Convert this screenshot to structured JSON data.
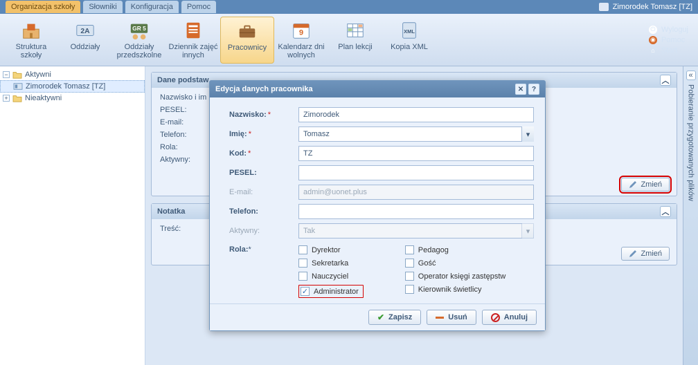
{
  "header": {
    "tabs": [
      "Organizacja szkoły",
      "Słowniki",
      "Konfiguracja",
      "Pomoc"
    ],
    "active_tab": 0,
    "user": "Zimorodek Tomasz [TZ]",
    "links": {
      "logout": "Wyloguj",
      "help": "Pomoc",
      "start": "Start"
    }
  },
  "ribbon": {
    "items": [
      {
        "label": "Struktura szkoły"
      },
      {
        "label": "Oddziały",
        "badge": "2A"
      },
      {
        "label": "Oddziały przedszkolne",
        "badge": "GR 5"
      },
      {
        "label": "Dziennik zajęć innych"
      },
      {
        "label": "Pracownicy"
      },
      {
        "label": "Kalendarz dni wolnych"
      },
      {
        "label": "Plan lekcji"
      },
      {
        "label": "Kopia XML"
      }
    ],
    "active": 4
  },
  "tree": {
    "active_label": "Aktywni",
    "active_child": "Zimorodek Tomasz [TZ]",
    "inactive_label": "Nieaktywni"
  },
  "panel_main": {
    "title": "Dane podstaw",
    "fields": {
      "name_label": "Nazwisko i im",
      "pesel_label": "PESEL:",
      "email_label": "E-mail:",
      "telefon_label": "Telefon:",
      "rola_label": "Rola:",
      "aktywny_label": "Aktywny:"
    },
    "btn": "Zmień"
  },
  "panel_note": {
    "title": "Notatka",
    "tresc_label": "Treść:",
    "btn": "Zmień"
  },
  "sider": {
    "text": "Pobieranie przygotowanych plików"
  },
  "dialog": {
    "title": "Edycja danych pracownika",
    "labels": {
      "nazwisko": "Nazwisko:",
      "imie": "Imię:",
      "kod": "Kod:",
      "pesel": "PESEL:",
      "email": "E-mail:",
      "telefon": "Telefon:",
      "aktywny": "Aktywny:",
      "rola": "Rola:"
    },
    "values": {
      "nazwisko": "Zimorodek",
      "imie": "Tomasz",
      "kod": "TZ",
      "pesel": "",
      "email": "admin@uonet.plus",
      "telefon": "",
      "aktywny": "Tak"
    },
    "roles_left": [
      "Dyrektor",
      "Sekretarka",
      "Nauczyciel",
      "Administrator"
    ],
    "roles_right": [
      "Pedagog",
      "Gość",
      "Operator księgi zastępstw",
      "Kierownik świetlicy"
    ],
    "roles_checked": [
      "Administrator"
    ],
    "buttons": {
      "save": "Zapisz",
      "delete": "Usuń",
      "cancel": "Anuluj"
    }
  }
}
